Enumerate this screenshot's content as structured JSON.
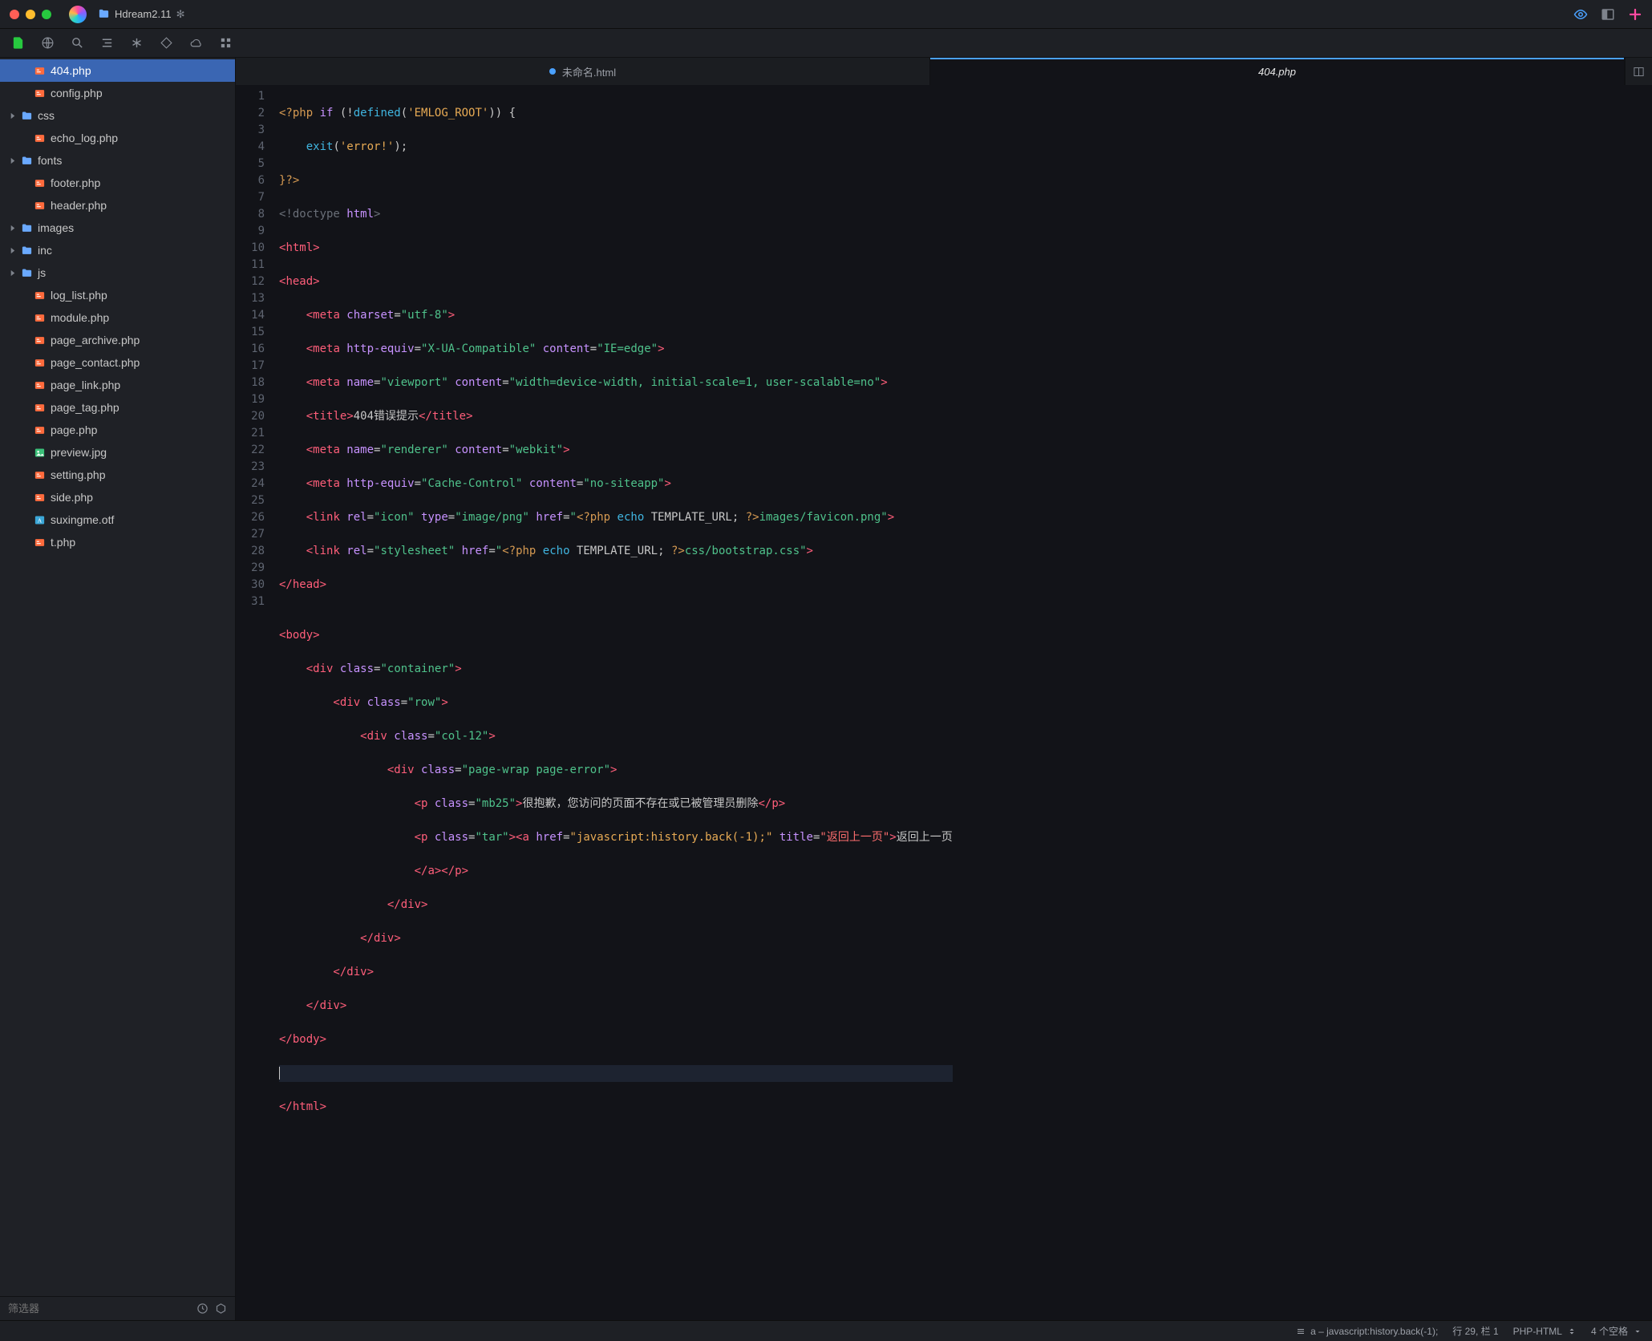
{
  "titlebar": {
    "project_name": "Hdream2.11",
    "modified_indicator": "✻"
  },
  "toolbar": {
    "icons": [
      "file",
      "globe",
      "search",
      "indent",
      "asterisk",
      "diamond",
      "cloud",
      "grid"
    ]
  },
  "sidebar": {
    "items": [
      {
        "name": "404.php",
        "type": "php",
        "indent": 1,
        "selected": true
      },
      {
        "name": "config.php",
        "type": "php",
        "indent": 1
      },
      {
        "name": "css",
        "type": "folder",
        "indent": 0,
        "chevron": true
      },
      {
        "name": "echo_log.php",
        "type": "php",
        "indent": 1
      },
      {
        "name": "fonts",
        "type": "folder",
        "indent": 0,
        "chevron": true
      },
      {
        "name": "footer.php",
        "type": "php",
        "indent": 1
      },
      {
        "name": "header.php",
        "type": "php",
        "indent": 1
      },
      {
        "name": "images",
        "type": "folder",
        "indent": 0,
        "chevron": true
      },
      {
        "name": "inc",
        "type": "folder",
        "indent": 0,
        "chevron": true
      },
      {
        "name": "js",
        "type": "folder",
        "indent": 0,
        "chevron": true
      },
      {
        "name": "log_list.php",
        "type": "php",
        "indent": 1
      },
      {
        "name": "module.php",
        "type": "php",
        "indent": 1
      },
      {
        "name": "page_archive.php",
        "type": "php",
        "indent": 1
      },
      {
        "name": "page_contact.php",
        "type": "php",
        "indent": 1
      },
      {
        "name": "page_link.php",
        "type": "php",
        "indent": 1
      },
      {
        "name": "page_tag.php",
        "type": "php",
        "indent": 1
      },
      {
        "name": "page.php",
        "type": "php",
        "indent": 1
      },
      {
        "name": "preview.jpg",
        "type": "img",
        "indent": 1
      },
      {
        "name": "setting.php",
        "type": "php",
        "indent": 1
      },
      {
        "name": "side.php",
        "type": "php",
        "indent": 1
      },
      {
        "name": "suxingme.otf",
        "type": "font",
        "indent": 1
      },
      {
        "name": "t.php",
        "type": "php",
        "indent": 1
      }
    ],
    "filter_placeholder": "筛选器"
  },
  "tabs": [
    {
      "label": "未命名.html",
      "modified": true,
      "active": false
    },
    {
      "label": "404.php",
      "modified": false,
      "active": true
    }
  ],
  "code_lines_count": 31,
  "code": {
    "l1": {
      "a": "<?php",
      "b": " if ",
      "c": "(!",
      "d": "defined",
      "e": "(",
      "f": "'EMLOG_ROOT'",
      "g": ")) {"
    },
    "l2": {
      "a": "    exit",
      "b": "(",
      "c": "'error!'",
      "d": ");"
    },
    "l3": {
      "a": "}?>"
    },
    "l4": {
      "a": "<!doctype ",
      "b": "html",
      "c": ">"
    },
    "l5": {
      "a": "<",
      "b": "html",
      "c": ">"
    },
    "l6": {
      "a": "<",
      "b": "head",
      "c": ">"
    },
    "l7": {
      "a": "    <",
      "b": "meta",
      "c": " charset",
      "d": "=",
      "e": "\"utf-8\"",
      "f": ">"
    },
    "l8": {
      "a": "    <",
      "b": "meta",
      "c": " http-equiv",
      "d": "=",
      "e": "\"X-UA-Compatible\"",
      "f": " content",
      "g": "=",
      "h": "\"IE=edge\"",
      "i": ">"
    },
    "l9": {
      "a": "    <",
      "b": "meta",
      "c": " name",
      "d": "=",
      "e": "\"viewport\"",
      "f": " content",
      "g": "=",
      "h": "\"width=device-width, initial-scale=1, user-scalable=no\"",
      "i": ">"
    },
    "l10": {
      "a": "    <",
      "b": "title",
      "c": ">",
      "d": "404错误提示",
      "e": "</",
      "f": "title",
      "g": ">"
    },
    "l11": {
      "a": "    <",
      "b": "meta",
      "c": " name",
      "d": "=",
      "e": "\"renderer\"",
      "f": " content",
      "g": "=",
      "h": "\"webkit\"",
      "i": ">"
    },
    "l12": {
      "a": "    <",
      "b": "meta",
      "c": " http-equiv",
      "d": "=",
      "e": "\"Cache-Control\"",
      "f": " content",
      "g": "=",
      "h": "\"no-siteapp\"",
      "i": ">"
    },
    "l13": {
      "a": "    <",
      "b": "link",
      "c": " rel",
      "d": "=",
      "e": "\"icon\"",
      "f": " type",
      "g": "=",
      "h": "\"image/png\"",
      "i": " href",
      "j": "=",
      "k": "\"",
      "l": "<?php ",
      "m": "echo ",
      "n": "TEMPLATE_URL; ",
      "o": "?>",
      "p": "images/favicon.png\"",
      "q": ">"
    },
    "l14": {
      "a": "    <",
      "b": "link",
      "c": " rel",
      "d": "=",
      "e": "\"stylesheet\"",
      "f": " href",
      "g": "=",
      "h": "\"",
      "i": "<?php ",
      "j": "echo ",
      "k": "TEMPLATE_URL; ",
      "l": "?>",
      "m": "css/bootstrap.css\"",
      "n": ">"
    },
    "l15": {
      "a": "</",
      "b": "head",
      "c": ">"
    },
    "l16": {
      "a": ""
    },
    "l17": {
      "a": "<",
      "b": "body",
      "c": ">"
    },
    "l18": {
      "a": "    <",
      "b": "div",
      "c": " class",
      "d": "=",
      "e": "\"container\"",
      "f": ">"
    },
    "l19": {
      "a": "        <",
      "b": "div",
      "c": " class",
      "d": "=",
      "e": "\"row\"",
      "f": ">"
    },
    "l20": {
      "a": "            <",
      "b": "div",
      "c": " class",
      "d": "=",
      "e": "\"col-12\"",
      "f": ">"
    },
    "l21": {
      "a": "                <",
      "b": "div",
      "c": " class",
      "d": "=",
      "e": "\"page-wrap page-error\"",
      "f": ">"
    },
    "l22": {
      "a": "                    <",
      "b": "p",
      "c": " class",
      "d": "=",
      "e": "\"mb25\"",
      "f": ">",
      "g": "很抱歉，您访问的页面不存在或已被管理员删除",
      "h": "</",
      "i": "p",
      "j": ">"
    },
    "l23": {
      "a": "                    <",
      "b": "p",
      "c": " class",
      "d": "=",
      "e": "\"tar\"",
      "f": "><",
      "g": "a",
      "h": " href",
      "i": "=",
      "j": "\"javascript:history.back(-1);\"",
      "k": " title",
      "l": "=",
      "m": "\"返回上一页\"",
      "n": ">",
      "o": "返回上一页"
    },
    "l23b": {
      "a": "                    </",
      "b": "a",
      "c": "></",
      "d": "p",
      "e": ">"
    },
    "l24": {
      "a": "                </",
      "b": "div",
      "c": ">"
    },
    "l25": {
      "a": "            </",
      "b": "div",
      "c": ">"
    },
    "l26": {
      "a": "        </",
      "b": "div",
      "c": ">"
    },
    "l27": {
      "a": "    </",
      "b": "div",
      "c": ">"
    },
    "l28": {
      "a": "</",
      "b": "body",
      "c": ">"
    },
    "l29": {
      "a": ""
    },
    "l30": {
      "a": "</",
      "b": "html",
      "c": ">"
    },
    "l31": {
      "a": ""
    }
  },
  "statusbar": {
    "breadcrumb": "a – javascript:history.back(-1);",
    "cursor": "行 29, 栏 1",
    "lang": "PHP-HTML",
    "indent": "4 个空格"
  }
}
